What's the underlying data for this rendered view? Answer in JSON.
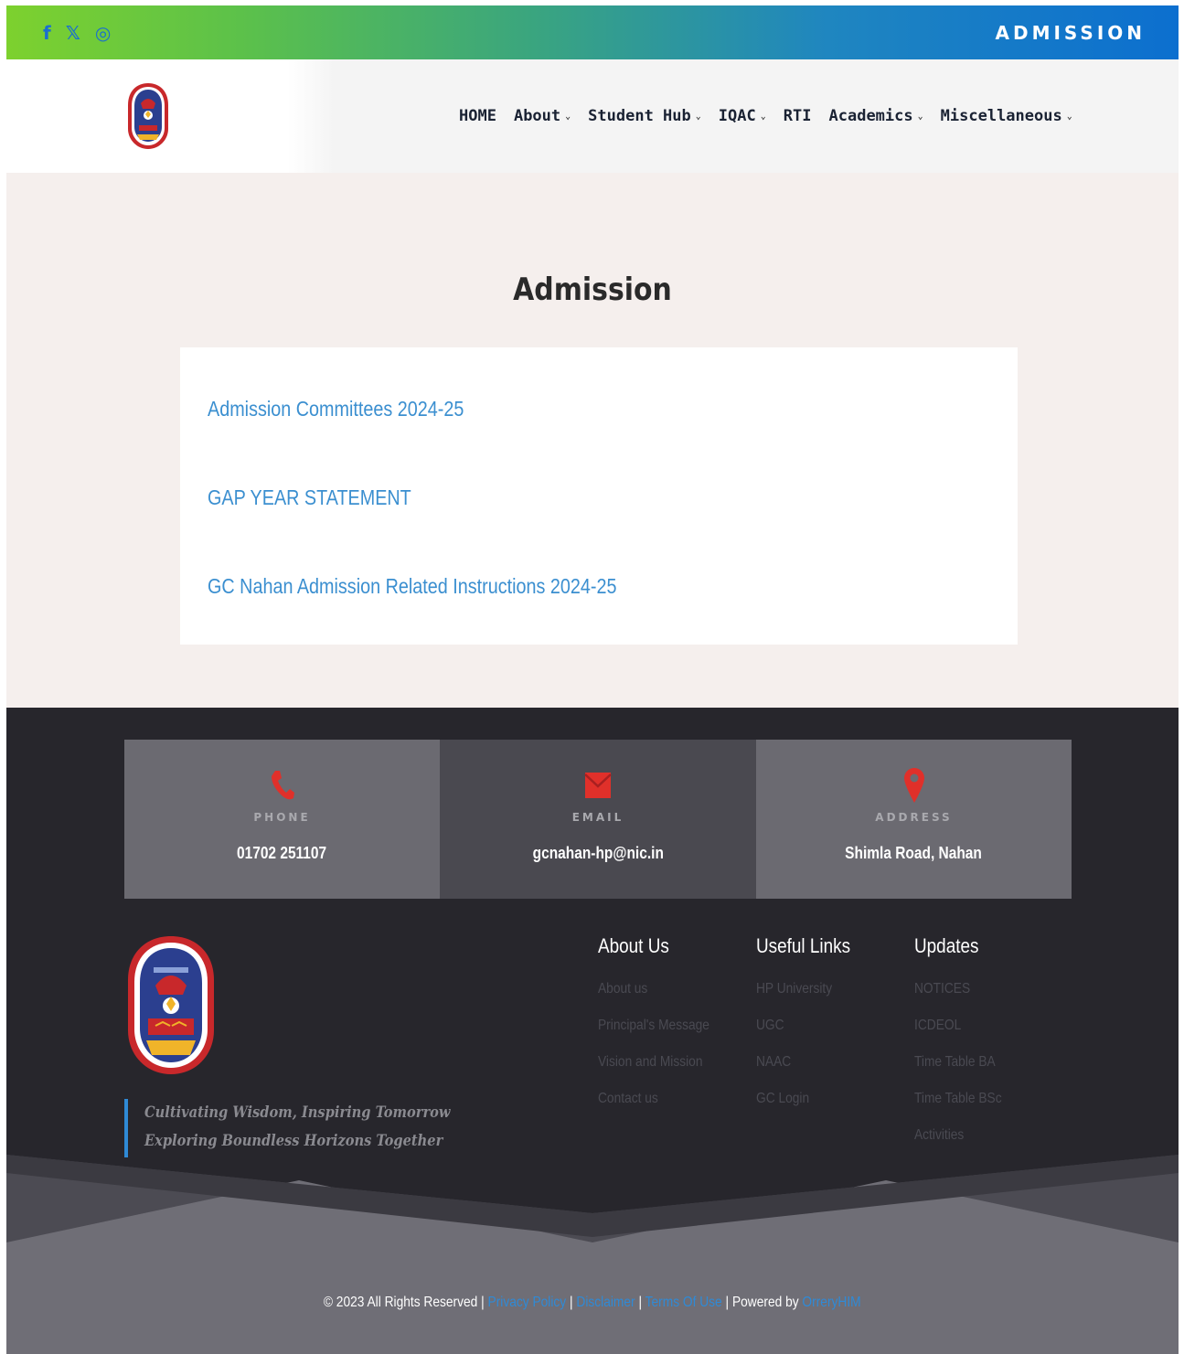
{
  "topbar": {
    "social": [
      {
        "icon": "facebook-icon",
        "glyph": "f"
      },
      {
        "icon": "x-twitter-icon",
        "glyph": "𝕏"
      },
      {
        "icon": "instagram-icon",
        "glyph": "◎"
      }
    ],
    "title": "ADMISSION"
  },
  "nav": {
    "items": [
      {
        "label": "HOME",
        "dropdown": false
      },
      {
        "label": "About",
        "dropdown": true
      },
      {
        "label": "Student Hub",
        "dropdown": true
      },
      {
        "label": "IQAC",
        "dropdown": true
      },
      {
        "label": "RTI",
        "dropdown": false
      },
      {
        "label": "Academics",
        "dropdown": true
      },
      {
        "label": "Miscellaneous",
        "dropdown": true
      }
    ]
  },
  "content": {
    "title": "Admission",
    "links": [
      "Admission Committees 2024-25",
      "GAP YEAR STATEMENT",
      "GC Nahan Admission Related Instructions 2024-25"
    ]
  },
  "footer": {
    "contacts": [
      {
        "icon": "phone-icon",
        "label": "PHONE",
        "value": "01702 251107"
      },
      {
        "icon": "email-icon",
        "label": "EMAIL",
        "value": "gcnahan-hp@nic.in"
      },
      {
        "icon": "location-pin-icon",
        "label": "ADDRESS",
        "value": "Shimla Road, Nahan"
      }
    ],
    "tagline": [
      "Cultivating Wisdom, Inspiring Tomorrow",
      "Exploring Boundless Horizons Together"
    ],
    "columns": {
      "about": {
        "title": "About Us",
        "links": [
          "About us",
          "Principal's Message",
          "Vision and Mission",
          "Contact us"
        ]
      },
      "useful": {
        "title": "Useful Links",
        "links": [
          "HP University",
          "UGC",
          "NAAC",
          "GC Login"
        ]
      },
      "updates": {
        "title": "Updates",
        "links": [
          "NOTICES",
          "ICDEOL",
          "Time Table BA",
          "Time Table BSc",
          "Activities"
        ]
      }
    },
    "copyright": {
      "text": "© 2023 All Rights Reserved |",
      "privacy": "Privacy Policy",
      "sep1": "|",
      "disclaimer": "Disclaimer",
      "sep2": "|",
      "terms": "Terms Of Use",
      "powered": "| Powered by",
      "powered_link": "OrreryHIM"
    }
  },
  "colors": {
    "accent": "#2f8ad6",
    "link": "#3b8fd0",
    "icon_red": "#e0302a",
    "footer_bg": "#27262c"
  }
}
